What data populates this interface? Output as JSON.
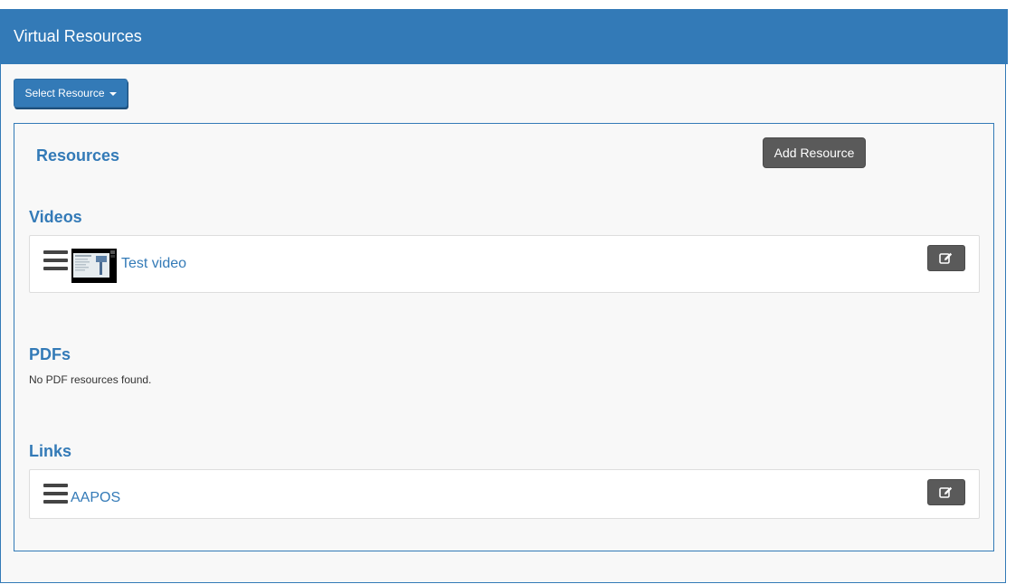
{
  "header": {
    "title": "Virtual Resources"
  },
  "toolbar": {
    "select_resource_label": "Select Resource"
  },
  "resources": {
    "title": "Resources",
    "add_button_label": "Add Resource"
  },
  "sections": {
    "videos": {
      "title": "Videos",
      "items": [
        {
          "label": "Test video"
        }
      ]
    },
    "pdfs": {
      "title": "PDFs",
      "empty_message": "No PDF resources found."
    },
    "links": {
      "title": "Links",
      "items": [
        {
          "label": "AAPOS"
        }
      ]
    }
  },
  "icons": {
    "drag_handle": "bars-icon",
    "edit": "edit-icon",
    "dropdown": "caret-down-icon"
  },
  "colors": {
    "primary": "#337ab7",
    "button_dark": "#5a5a5a",
    "panel_bg": "#f8f8f8"
  }
}
